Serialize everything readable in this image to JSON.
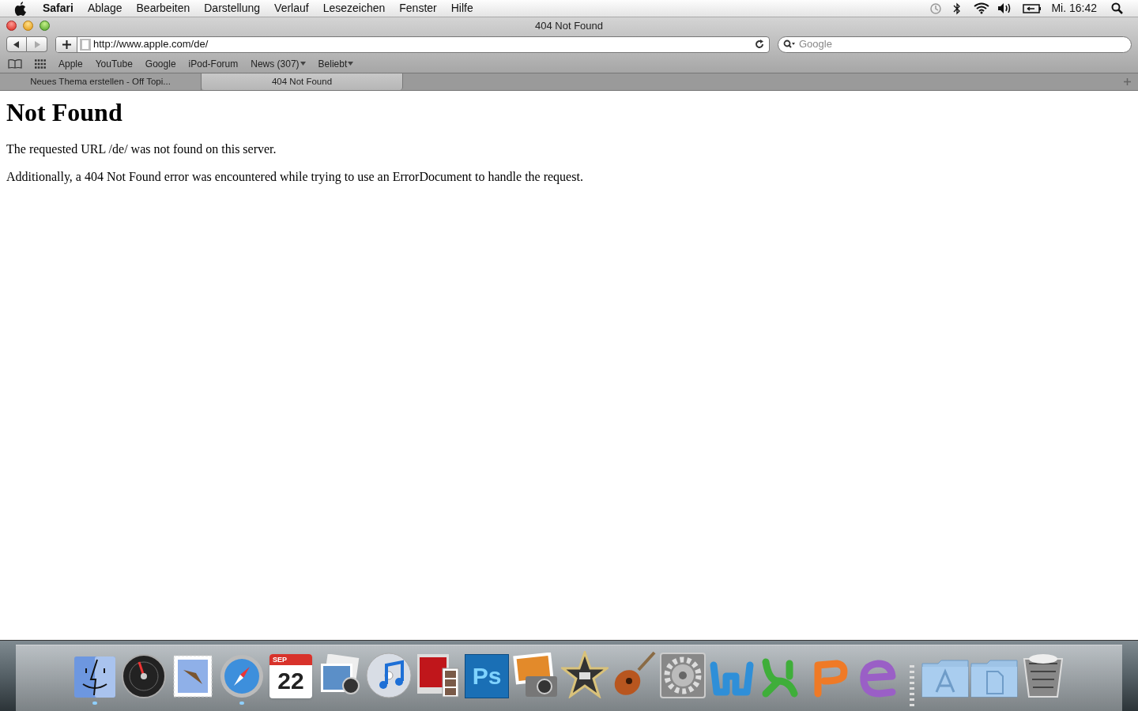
{
  "menu_bar": {
    "app_name": "Safari",
    "items": [
      "Ablage",
      "Bearbeiten",
      "Darstellung",
      "Verlauf",
      "Lesezeichen",
      "Fenster",
      "Hilfe"
    ],
    "clock": "Mi. 16:42"
  },
  "window": {
    "title": "404 Not Found"
  },
  "toolbar": {
    "back_disabled": false,
    "forward_disabled": true,
    "address": "http://www.apple.com/de/",
    "search": {
      "placeholder": "Google"
    }
  },
  "bookmarks": [
    {
      "label": "Apple",
      "menu": false
    },
    {
      "label": "YouTube",
      "menu": false
    },
    {
      "label": "Google",
      "menu": false
    },
    {
      "label": "iPod-Forum",
      "menu": false
    },
    {
      "label": "News (307)",
      "menu": true
    },
    {
      "label": "Beliebt",
      "menu": true
    }
  ],
  "tabs": [
    {
      "label": "Neues Thema erstellen - Off Topi...",
      "selected": false
    },
    {
      "label": "404 Not Found",
      "selected": true
    }
  ],
  "page": {
    "heading": "Not Found",
    "paragraphs": [
      "The requested URL /de/ was not found on this server.",
      "Additionally, a 404 Not Found error was encountered while trying to use an ErrorDocument to handle the request."
    ]
  },
  "dock": [
    {
      "kind": "finder",
      "running": true
    },
    {
      "kind": "dashboard",
      "running": false
    },
    {
      "kind": "mail",
      "running": false
    },
    {
      "kind": "safari",
      "running": true
    },
    {
      "kind": "calendar",
      "month": "SEP",
      "day": "22",
      "running": false
    },
    {
      "kind": "iphoto",
      "running": false
    },
    {
      "kind": "itunes",
      "running": false
    },
    {
      "kind": "photobooth",
      "running": false
    },
    {
      "kind": "photoshop",
      "label": "Ps",
      "running": false
    },
    {
      "kind": "imagecapture",
      "running": false
    },
    {
      "kind": "imovie",
      "running": false
    },
    {
      "kind": "garageband",
      "running": false
    },
    {
      "kind": "preferences",
      "running": false
    },
    {
      "kind": "word",
      "running": false
    },
    {
      "kind": "excel",
      "running": false
    },
    {
      "kind": "powerpoint",
      "running": false
    },
    {
      "kind": "entourage",
      "running": false
    },
    {
      "kind": "separator"
    },
    {
      "kind": "apps-folder",
      "running": false
    },
    {
      "kind": "docs-folder",
      "running": false
    },
    {
      "kind": "trash",
      "running": false
    }
  ]
}
